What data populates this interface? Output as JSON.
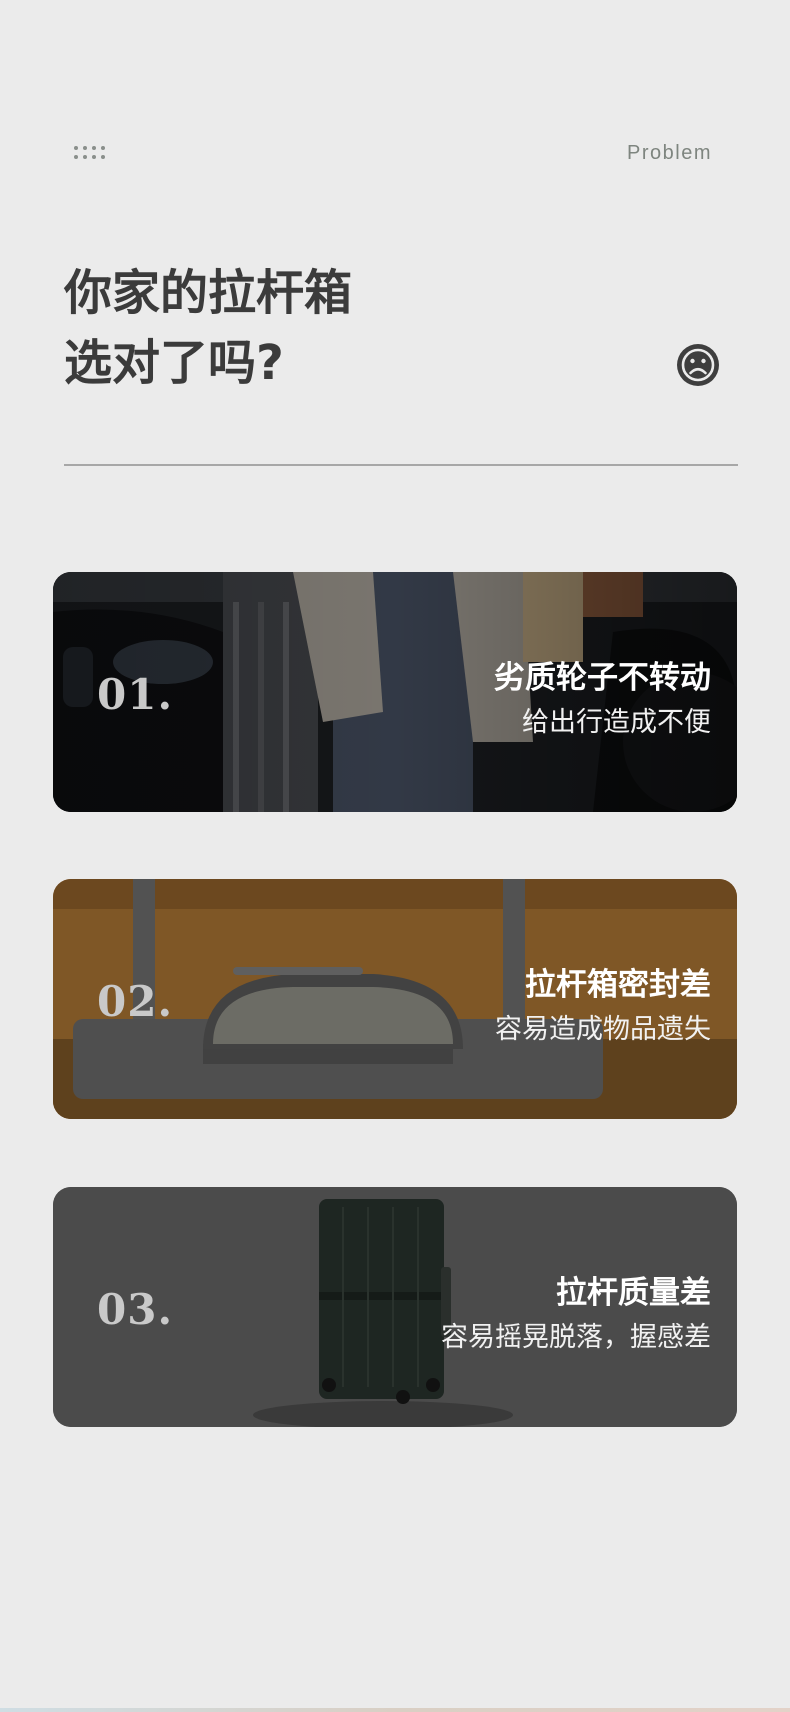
{
  "header": {
    "menu_icon": "dots-grid-icon",
    "label": "Problem",
    "title_line1": "你家的拉杆箱",
    "title_line2": "选对了吗?",
    "emotion_icon": "sad-face-icon"
  },
  "cards": [
    {
      "number": "01.",
      "title": "劣质轮子不转动",
      "subtitle": "给出行造成不便"
    },
    {
      "number": "02.",
      "title": "拉杆箱密封差",
      "subtitle": "容易造成物品遗失"
    },
    {
      "number": "03.",
      "title": "拉杆质量差",
      "subtitle": "容易摇晃脱落，握感差"
    }
  ]
}
